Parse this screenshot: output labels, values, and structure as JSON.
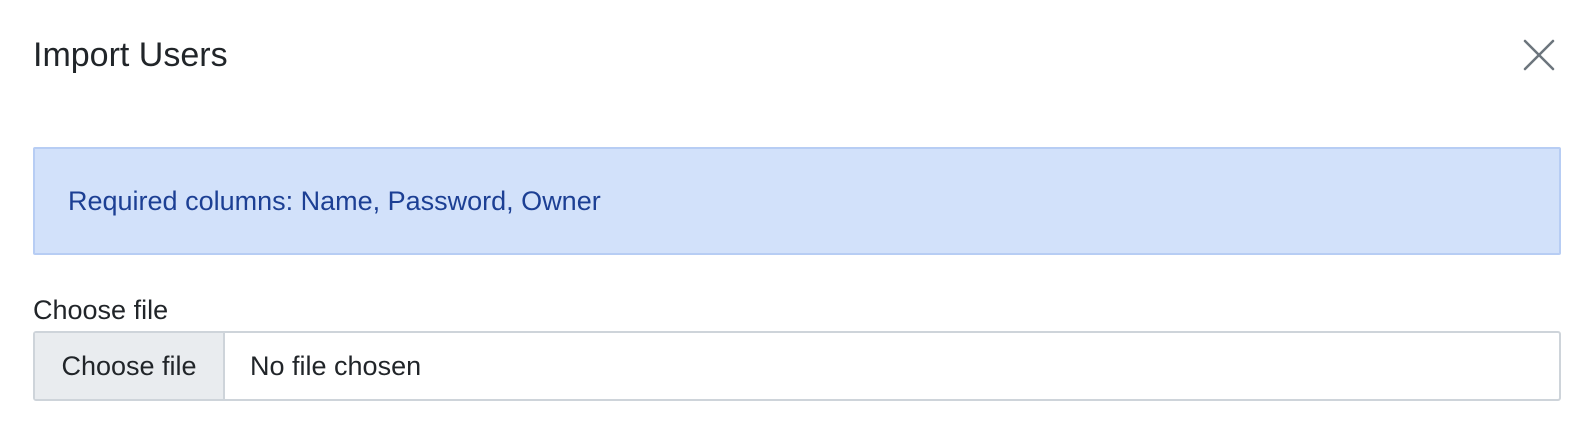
{
  "modal": {
    "title": "Import Users",
    "close_icon": "close-icon"
  },
  "alert": {
    "text": "Required columns: Name, Password, Owner",
    "background": "#d2e1fa",
    "border": "#b7cdf4",
    "text_color": "#1c3f94"
  },
  "file_field": {
    "label": "Choose file",
    "button_label": "Choose file",
    "status_text": "No file chosen"
  }
}
